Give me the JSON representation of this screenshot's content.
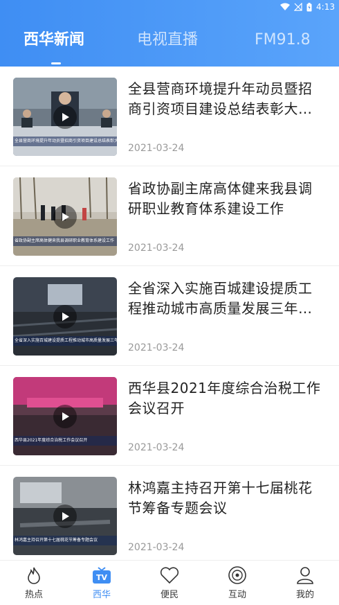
{
  "status_bar": {
    "time": "4:13"
  },
  "tabs": [
    {
      "label": "西华新闻",
      "active": true
    },
    {
      "label": "电视直播",
      "active": false
    },
    {
      "label": "FM91.8",
      "active": false
    }
  ],
  "news": [
    {
      "title": "全县营商环境提升年动员暨招商引资项目建设总结表彰大会召开",
      "date": "2021-03-24",
      "caption": "全县营商环境提升年动员暨招商引资项目建设总结表彰大会召开"
    },
    {
      "title": "省政协副主席高体健来我县调研职业教育体系建设工作",
      "date": "2021-03-24",
      "caption": "省政协副主席高体健来我县调研职业教育体系建设工作"
    },
    {
      "title": "全省深入实施百城建设提质工程推动城市高质量发展三年行动电视电话会议召开",
      "date": "2021-03-24",
      "caption": "全省深入实施百城建设提质工程推动城市高质量发展三年行动"
    },
    {
      "title": "西华县2021年度综合治税工作会议召开",
      "date": "2021-03-24",
      "caption": "西华县2021年度综合治税工作会议召开"
    },
    {
      "title": "林鸿嘉主持召开第十七届桃花节筹备专题会议",
      "date": "2021-03-24",
      "caption": "林鸿嘉主持召开第十七届桃花节筹备专题会议"
    }
  ],
  "bottom_nav": [
    {
      "label": "热点",
      "icon": "flame-icon",
      "active": false
    },
    {
      "label": "西华",
      "icon": "tv-icon",
      "active": true
    },
    {
      "label": "便民",
      "icon": "heart-icon",
      "active": false
    },
    {
      "label": "互动",
      "icon": "disc-icon",
      "active": false
    },
    {
      "label": "我的",
      "icon": "user-icon",
      "active": false
    }
  ],
  "colors": {
    "accent": "#3f8ef3",
    "header_start": "#3f8ef3",
    "header_end": "#5aa4fb"
  }
}
